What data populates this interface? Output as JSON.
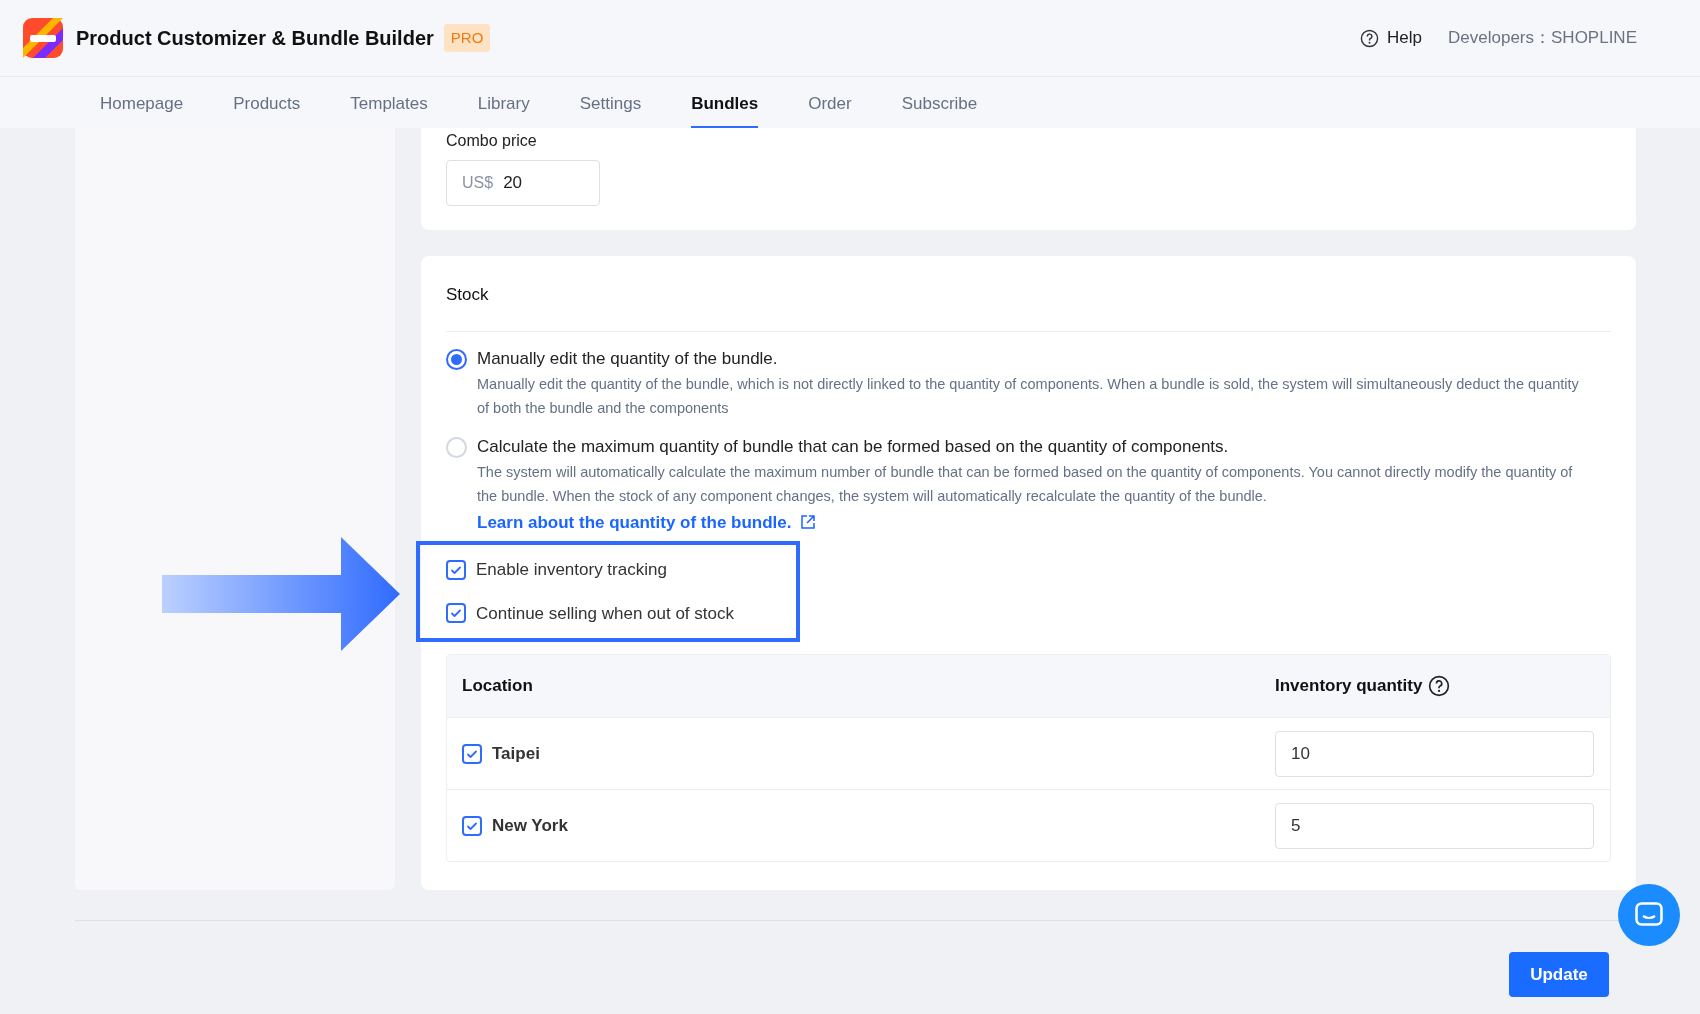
{
  "header": {
    "app_name": "Product Customizer & Bundle Builder",
    "badge": "PRO",
    "help": "Help",
    "developer_label": "Developers：",
    "developer": "SHOPLINE"
  },
  "tabs": [
    {
      "label": "Homepage",
      "selected": false
    },
    {
      "label": "Products",
      "selected": false
    },
    {
      "label": "Templates",
      "selected": false
    },
    {
      "label": "Library",
      "selected": false
    },
    {
      "label": "Settings",
      "selected": false
    },
    {
      "label": "Bundles",
      "selected": true
    },
    {
      "label": "Order",
      "selected": false
    },
    {
      "label": "Subscribe",
      "selected": false
    }
  ],
  "combo_price": {
    "label": "Combo price",
    "prefix": "US$",
    "value": "20"
  },
  "stock": {
    "title": "Stock",
    "options": [
      {
        "label": "Manually edit the quantity of the bundle.",
        "description": "Manually edit the quantity of the bundle, which is not directly linked to the quantity of components. When a bundle is sold, the system will simultaneously deduct the quantity of both the bundle and the components",
        "selected": true
      },
      {
        "label": "Calculate the maximum quantity of bundle that can be formed based on the quantity of components.",
        "description": "The system will automatically calculate the maximum number of bundle that can be formed based on the quantity of components. You cannot directly modify the quantity of the bundle. When the stock of any component changes, the system will automatically recalculate the quantity of the bundle.",
        "link": "Learn about the quantity of the bundle.",
        "selected": false
      }
    ],
    "checkboxes": [
      {
        "label": "Enable inventory tracking",
        "checked": true
      },
      {
        "label": "Continue selling when out of stock",
        "checked": true
      }
    ],
    "table": {
      "columns": [
        "Location",
        "Inventory quantity"
      ],
      "rows": [
        {
          "location": "Taipei",
          "checked": true,
          "quantity": "10"
        },
        {
          "location": "New York",
          "checked": true,
          "quantity": "5"
        }
      ]
    }
  },
  "update_button": "Update"
}
